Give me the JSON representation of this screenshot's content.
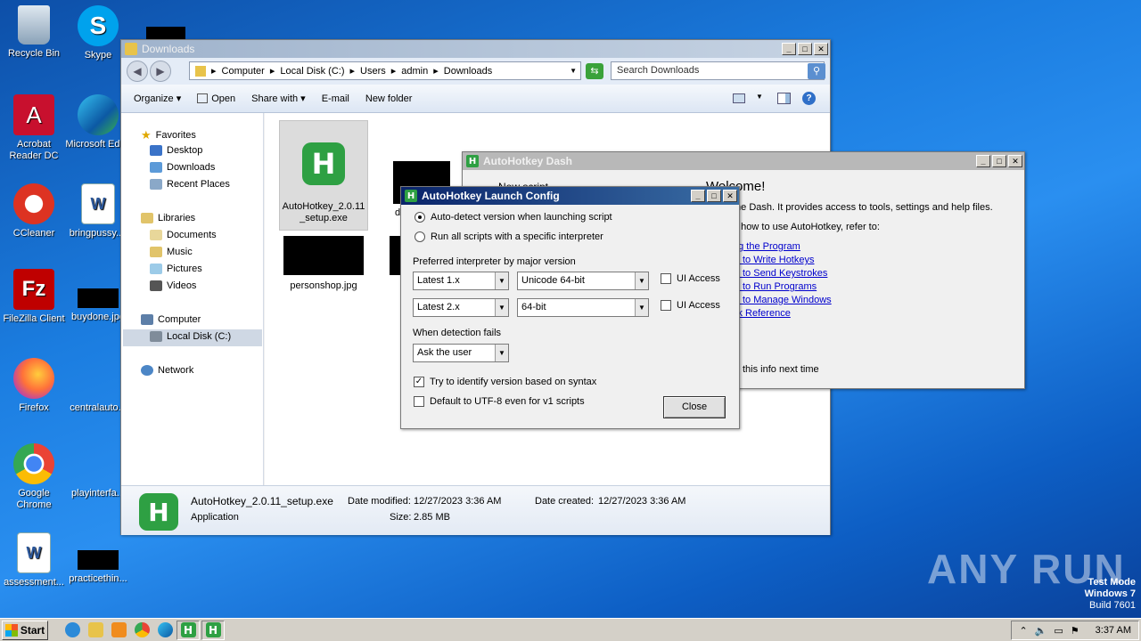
{
  "desktop": {
    "icons": [
      {
        "label": "Recycle Bin"
      },
      {
        "label": "Skype"
      },
      {
        "label": "Acrobat Reader DC"
      },
      {
        "label": "Microsoft Edge"
      },
      {
        "label": "CCleaner"
      },
      {
        "label": "bringpussy...."
      },
      {
        "label": "FileZilla Client"
      },
      {
        "label": "buydone.jpg"
      },
      {
        "label": "Firefox"
      },
      {
        "label": "centralauto..."
      },
      {
        "label": "Google Chrome"
      },
      {
        "label": "playinterfa..."
      },
      {
        "label": "assessment..."
      },
      {
        "label": "practicethin..."
      }
    ],
    "watermark": "ANY RUN",
    "os_info": {
      "line1": "Test Mode",
      "line2": "Windows 7",
      "line3": "Build 7601"
    }
  },
  "explorer": {
    "title": "Downloads",
    "breadcrumb": [
      "Computer",
      "Local Disk (C:)",
      "Users",
      "admin",
      "Downloads"
    ],
    "search_placeholder": "Search Downloads",
    "toolbar": {
      "organize": "Organize",
      "open": "Open",
      "share_with": "Share with",
      "email": "E-mail",
      "new_folder": "New folder"
    },
    "nav": {
      "favorites": "Favorites",
      "desktop": "Desktop",
      "downloads": "Downloads",
      "recent": "Recent Places",
      "libraries": "Libraries",
      "documents": "Documents",
      "music": "Music",
      "pictures": "Pictures",
      "videos": "Videos",
      "computer": "Computer",
      "local_disk": "Local Disk (C:)",
      "network": "Network"
    },
    "files": [
      {
        "name": "AutoHotkey_2.0.11_setup.exe"
      },
      {
        "name": "d"
      },
      {
        "name": "personshop.jpg"
      }
    ],
    "details": {
      "filename": "AutoHotkey_2.0.11_setup.exe",
      "type": "Application",
      "modified_label": "Date modified:",
      "modified": "12/27/2023 3:36 AM",
      "created_label": "Date created:",
      "created": "12/27/2023 3:36 AM",
      "size_label": "Size:",
      "size": "2.85 MB"
    }
  },
  "dash": {
    "title": "AutoHotkey Dash",
    "heading": "Welcome!",
    "new_script": "New script",
    "intro": "the Dash. It provides access to tools, settings and help files.",
    "howto": "n how to use AutoHotkey, refer to:",
    "links": [
      "ng the Program",
      "w to Write Hotkeys",
      "w to Send Keystrokes",
      "w to Run Programs",
      "w to Manage Windows",
      "ck Reference"
    ],
    "footer": "w this info next time"
  },
  "config": {
    "title": "AutoHotkey Launch Config",
    "radio_auto": "Auto-detect version when launching script",
    "radio_specific": "Run all scripts with a specific interpreter",
    "preferred_label": "Preferred interpreter by major version",
    "v1_version": "Latest 1.x",
    "v1_build": "Unicode 64-bit",
    "v2_version": "Latest 2.x",
    "v2_build": "64-bit",
    "ui_access": "UI Access",
    "fail_label": "When detection fails",
    "fail_value": "Ask the user",
    "try_identify": "Try to identify version based on syntax",
    "utf8": "Default to UTF-8 even for v1 scripts",
    "close": "Close"
  },
  "taskbar": {
    "start": "Start",
    "clock": "3:37 AM"
  }
}
